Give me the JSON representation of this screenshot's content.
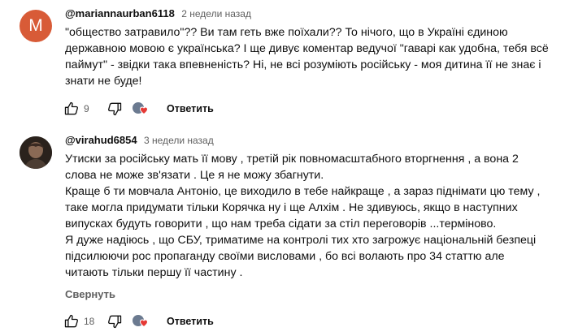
{
  "comments": [
    {
      "avatar_letter": "M",
      "avatar_color": "#d85b37",
      "author": "@mariannaurban6118",
      "time": "2 недели назад",
      "lines": [
        "\"общество затравило\"?? Ви там геть вже поїхали?? То нічого, що в Україні єдиною",
        "державною мовою є українська? І ще дивує коментар ведучої \"гаварі как удобна, тебя всё",
        "паймут\" - звідки така впевненість? Ні, не всі розуміють російську - моя дитина її не знає і",
        "знати не буде!"
      ],
      "likes": "9",
      "reply_label": "Ответить"
    },
    {
      "author": "@virahud6854",
      "time": "3 недели назад",
      "lines": [
        "Утиски за російську мать її мову , третій рік повномасштабного вторгнення , а вона 2",
        "слова не може зв'язати . Це я не можу збагнути.",
        "Краще б ти мовчала Антоніо, це виходило в тебе найкраще , а зараз піднімати цю тему ,",
        "таке могла придумати тільки Корячка ну і ще Алхім . Не здивуюсь, якщо в наступних",
        "випусках будуть говорити , що нам треба сідати за стіл переговорів ...терміново.",
        "Я дуже надіюсь , що СБУ, триматиме на контролі тих хто загрожує національній безпеці",
        "підсилюючи рос пропаганду  своїми висловами , бо всі волають про 34 статтю але",
        "читають тільки першу її частину ."
      ],
      "collapse_label": "Свернуть",
      "likes": "18",
      "reply_label": "Ответить"
    }
  ],
  "icons": {
    "like": "thumb-up-icon",
    "dislike": "thumb-down-icon",
    "creator_heart": "creator-heart-icon"
  },
  "colors": {
    "text": "#0f0f0f",
    "secondary": "#606060",
    "heart": "#e53935"
  }
}
